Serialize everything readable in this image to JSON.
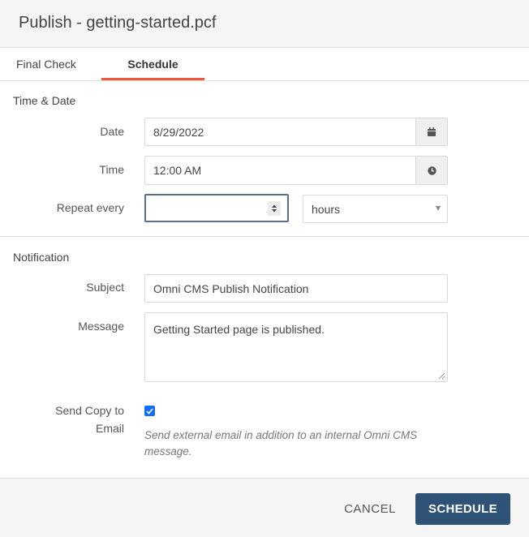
{
  "header": {
    "title": "Publish - getting-started.pcf"
  },
  "tabs": [
    {
      "label": "Final Check",
      "active": false
    },
    {
      "label": "Schedule",
      "active": true
    }
  ],
  "time_date": {
    "section_title": "Time & Date",
    "date": {
      "label": "Date",
      "value": "8/29/2022",
      "icon": "calendar-icon"
    },
    "time": {
      "label": "Time",
      "value": "12:00 AM",
      "icon": "clock-icon"
    },
    "repeat": {
      "label": "Repeat every",
      "value": "",
      "unit_selected": "hours"
    }
  },
  "notification": {
    "section_title": "Notification",
    "subject": {
      "label": "Subject",
      "value": "Omni CMS Publish Notification"
    },
    "message": {
      "label": "Message",
      "value": "Getting Started page is published."
    },
    "send_copy": {
      "label_line1": "Send Copy to",
      "label_line2": "Email",
      "checked": true,
      "help": "Send external email in addition to an internal Omni CMS message."
    }
  },
  "footer": {
    "cancel_label": "CANCEL",
    "schedule_label": "SCHEDULE"
  },
  "colors": {
    "accent": "#f0573a",
    "primary": "#2f5277",
    "checkbox": "#0d6efd"
  }
}
